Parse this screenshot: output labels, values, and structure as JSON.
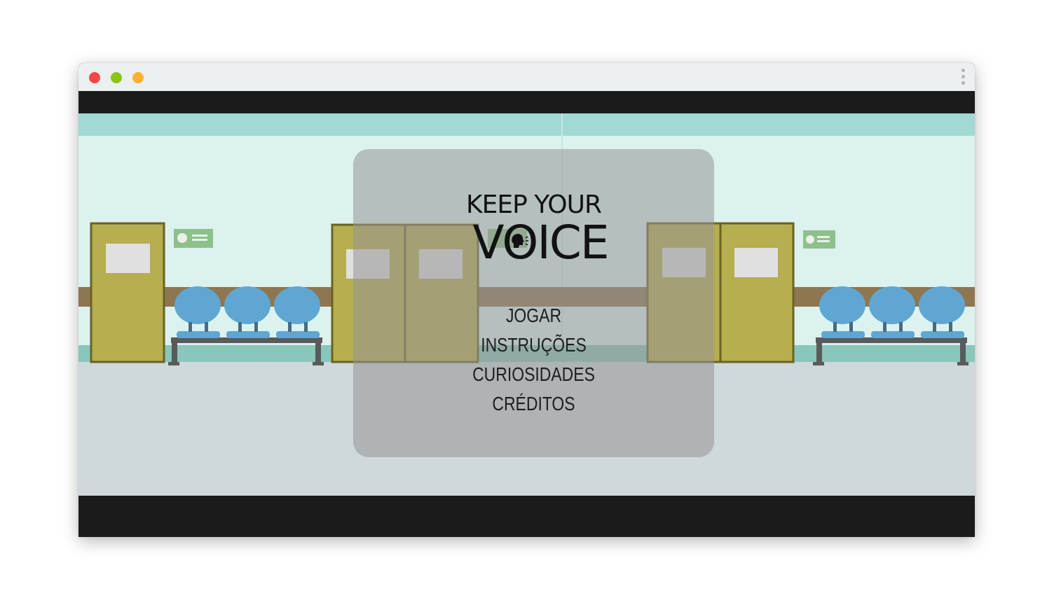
{
  "window": {
    "traffic_lights": {
      "close_color": "#f94545",
      "minimize_color": "#8bc415",
      "maximize_color": "#fbb22f"
    },
    "menu_icon": "kebab-vertical-icon"
  },
  "game": {
    "logo": {
      "line1": "KEEP YOUR",
      "line2": "VOICE",
      "icon": "speaking-head-icon"
    },
    "menu": {
      "play": "JOGAR",
      "instructions": "INSTRUÇÕES",
      "curiosities": "CURIOSIDADES",
      "credits": "CRÉDITOS"
    },
    "colors": {
      "wall": "#dbf2ef",
      "wall_band": "#a1d9d5",
      "rail": "#8e7651",
      "floor": "#cfd8db",
      "door": "#b6ae4f",
      "chair": "#5fa7d2",
      "letterbox": "#1b1b1b"
    }
  }
}
